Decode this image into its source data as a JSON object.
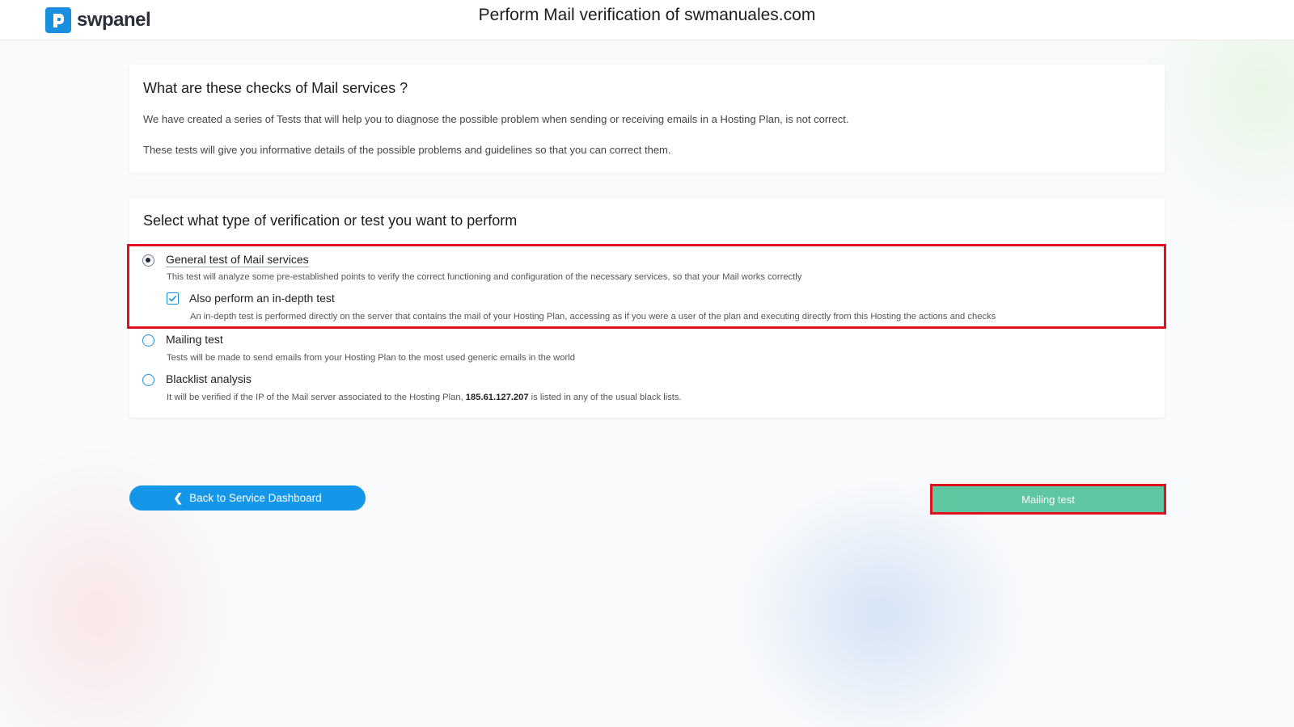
{
  "header": {
    "brand": "swpanel",
    "title": "Perform Mail verification of swmanuales.com"
  },
  "info_card": {
    "heading": "What are these checks of Mail services ?",
    "paragraph_1": "We have created a series of Tests that will help you to diagnose the possible problem when sending or receiving emails in a Hosting Plan, is not correct.",
    "paragraph_2": "These tests will give you informative details of the possible problems and guidelines so that you can correct them."
  },
  "select_card": {
    "heading": "Select what type of verification or test you want to perform",
    "options": [
      {
        "label": "General test of Mail services",
        "description": "This test will analyze some pre-established points to verify the correct functioning and configuration of the necessary services, so that your Mail works correctly",
        "selected": true
      },
      {
        "label": "Mailing test",
        "description": "Tests will be made to send emails from your Hosting Plan to the most used generic emails in the world",
        "selected": false
      },
      {
        "label": "Blacklist analysis",
        "description_prefix": "It will be verified if the IP of the Mail server associated to the Hosting Plan, ",
        "ip": "185.61.127.207",
        "description_suffix": " is listed in any of the usual black lists.",
        "selected": false
      }
    ],
    "indepth": {
      "label": "Also perform an in-depth test",
      "description": "An in-depth test is performed directly on the server that contains the mail of your Hosting Plan, accessing as if you were a user of the plan and executing directly from this Hosting the actions and checks",
      "checked": true
    }
  },
  "actions": {
    "back_label": "Back to Service Dashboard",
    "submit_label": "Mailing test"
  },
  "colors": {
    "accent_blue": "#1496e9",
    "submit_green": "#5fc6a2",
    "highlight_red": "#e0101c"
  },
  "icons": {
    "logo": "swpanel-logo-icon",
    "back": "chevron-left-icon",
    "checkbox": "checkmark-icon"
  }
}
